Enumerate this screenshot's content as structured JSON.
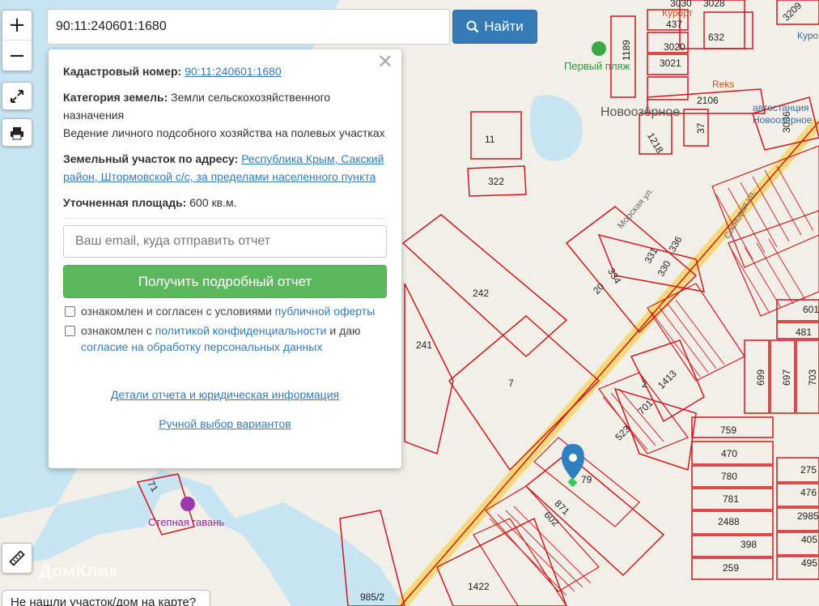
{
  "search": {
    "value": "90:11:240601:1680",
    "button_label": "Найти"
  },
  "controls": {
    "zoom_in": "+",
    "zoom_out": "−"
  },
  "panel": {
    "cadastral_label": "Кадастровый номер:",
    "cadastral_value": "90:11:240601:1680",
    "category_label": "Категория земель:",
    "category_value": "Земли сельскохозяйственного назначения",
    "usage_value": "Ведение личного подсобного хозяйства на полевых участках",
    "address_label": "Земельный участок по адресу:",
    "address_value": "Республика Крым, Сакский район, Штормовской с/с, за пределами населенного пункта",
    "area_label": "Уточненная площадь:",
    "area_value": "600 кв.м.",
    "email_placeholder": "Ваш email, куда отправить отчет",
    "report_button": "Получить подробный отчет",
    "consent1_pre": "ознакомлен и согласен с условиями",
    "consent1_link": "публичной оферты",
    "consent2_pre": "ознакомлен с",
    "consent2_link": "политикой конфиденциальности",
    "consent2_mid": "и даю",
    "consent2_link2": "согласие на обработку персональных данных",
    "details_link": "Детали отчета и юридическая информация",
    "manual_link": "Ручной выбор вариантов"
  },
  "bottom_tab": "Не нашли участок/дом на карте?",
  "watermark": "ДомКлик",
  "map": {
    "places": [
      "Новоозёрное",
      "Первый пляж",
      "Степная гавань",
      "Reks",
      "автостанция Новоозерное",
      "Морская ул.",
      "Сосновая ул.",
      "Курорт"
    ],
    "parcels": [
      "11",
      "322",
      "242",
      "241",
      "7",
      "20",
      "334",
      "331",
      "330",
      "336",
      "2",
      "1413",
      "701",
      "523",
      "79",
      "871",
      "602",
      "1422",
      "985/2",
      "71",
      "601",
      "481",
      "699",
      "697",
      "703",
      "759",
      "470",
      "780",
      "781",
      "2488",
      "398",
      "259",
      "275",
      "476",
      "2985",
      "405",
      "495",
      "437",
      "632",
      "3020",
      "3021",
      "3030",
      "3028",
      "3209",
      "1189",
      "2106",
      "37",
      "1218",
      "3036"
    ]
  },
  "colors": {
    "water": "#c6e4f2",
    "land": "#f2efe9",
    "parcel_line": "#d0161a",
    "road": "#f5d97a",
    "search_btn": "#337ab7",
    "report_btn": "#5cb85c"
  }
}
